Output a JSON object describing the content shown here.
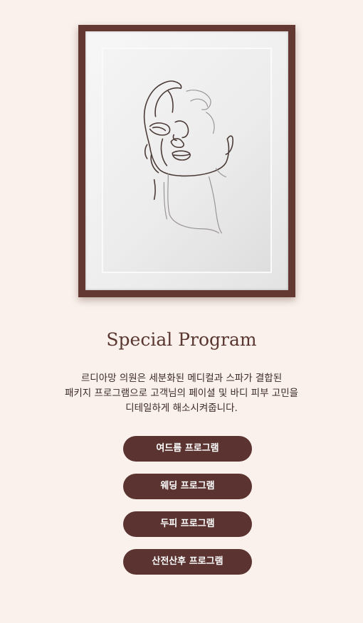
{
  "section": {
    "title": "Special Program",
    "description_lines": [
      "르디아망 의원은 세분화된 메디컬과 스파가 결합된",
      "패키지 프로그램으로 고객님의 페이셜 및 바디 피부 고민을",
      "디테일하게 해소시켜줍니다."
    ]
  },
  "buttons": [
    {
      "label": "여드름 프로그램"
    },
    {
      "label": "웨딩 프로그램"
    },
    {
      "label": "두피 프로그램"
    },
    {
      "label": "산전산후 프로그램"
    }
  ],
  "artwork": {
    "icon": "framed-line-art-face",
    "frame_color": "#633833"
  },
  "colors": {
    "background": "#faf1ec",
    "button": "#5b3431",
    "title": "#5a3630"
  }
}
